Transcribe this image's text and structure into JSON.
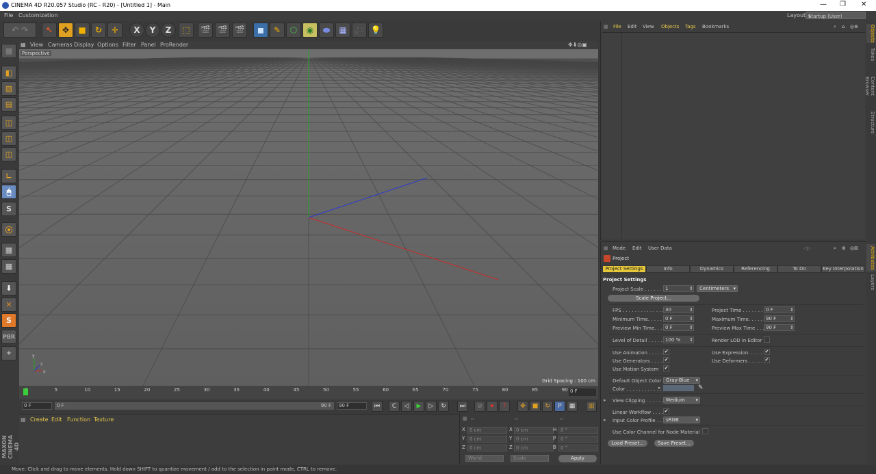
{
  "window": {
    "title": "CINEMA 4D R20.057 Studio (RC - R20) - [Untitled 1] - Main",
    "buttons": [
      "—",
      "❐",
      "✕"
    ]
  },
  "menubar": {
    "items": [
      "File",
      "Customization"
    ],
    "layout_label": "Layout:",
    "layout_value": "Startup (User)"
  },
  "viewport": {
    "menu": [
      "View",
      "Cameras",
      "Display",
      "Options",
      "Filter",
      "Panel",
      "ProRender"
    ],
    "camera_label": "Perspective",
    "grid_spacing": "Grid Spacing : 100 cm",
    "axis_labels": [
      "y",
      "z",
      "x"
    ]
  },
  "timeline": {
    "ticks": [
      "0",
      "5",
      "10",
      "15",
      "20",
      "25",
      "30",
      "35",
      "40",
      "45",
      "50",
      "55",
      "60",
      "65",
      "70",
      "75",
      "80",
      "85",
      "90"
    ],
    "end_frame": "0 F",
    "start_field": "0 F",
    "current_field": "0 F",
    "max_field": "90 F",
    "end_field": "90 F"
  },
  "material_manager": {
    "menu": [
      "Create",
      "Edit",
      "Function",
      "Texture"
    ]
  },
  "coordinates": {
    "header": [
      "--",
      "--",
      "--"
    ],
    "rows": [
      {
        "a": "X",
        "av": "0 cm",
        "b": "X",
        "bv": "0 cm",
        "c": "H",
        "cv": "0 °"
      },
      {
        "a": "Y",
        "av": "0 cm",
        "b": "Y",
        "bv": "0 cm",
        "c": "P",
        "cv": "0 °"
      },
      {
        "a": "Z",
        "av": "0 cm",
        "b": "Z",
        "bv": "0 cm",
        "c": "B",
        "cv": "0 °"
      }
    ],
    "world": "World",
    "scale": "Scale",
    "apply": "Apply"
  },
  "branding": "MAXON CINEMA 4D",
  "status": "Move: Click and drag to move elements. Hold down SHIFT to quantize movement / add to the selection in point mode, CTRL to remove.",
  "object_manager": {
    "menu": [
      "File",
      "Edit",
      "View",
      "Objects",
      "Tags",
      "Bookmarks"
    ]
  },
  "side_tabs_top": [
    "Objects",
    "Takes",
    "Content Browser",
    "Structure"
  ],
  "side_tabs_bottom": [
    "Attributes",
    "Layers"
  ],
  "attributes": {
    "menu": [
      "Mode",
      "Edit",
      "User Data"
    ],
    "object": "Project",
    "tabs": [
      "Project Settings",
      "Info",
      "Dynamics",
      "Referencing",
      "To Do",
      "Key Interpolation"
    ],
    "section": "Project Settings",
    "project_scale_label": "Project Scale . . . . . . .",
    "project_scale_value": "1",
    "project_scale_unit": "Centimeters",
    "scale_project_btn": "Scale Project...",
    "fps_label": "FPS . . . . . . . . . . . . . .",
    "fps_value": "30",
    "project_time_label": "Project Time . . . . . . .",
    "project_time_value": "0 F",
    "min_time_label": "Minimum Time. . . . . .",
    "min_time_value": "0 F",
    "max_time_label": "Maximum Time. . . . . .",
    "max_time_value": "90 F",
    "prev_min_label": "Preview Min Time. . . .",
    "prev_min_value": "0 F",
    "prev_max_label": "Preview Max Time . . .",
    "prev_max_value": "90 F",
    "lod_label": "Level of Detail . . . . . .",
    "lod_value": "100 %",
    "render_lod_label": "Render LOD in Editor",
    "use_anim_label": "Use Animation . . . . . .",
    "use_expr_label": "Use Expression. . . . . .",
    "use_gen_label": "Use Generators . . . . .",
    "use_def_label": "Use Deformers . . . . . .",
    "use_motion_label": "Use Motion System",
    "def_color_label": "Default Object Color",
    "def_color_value": "Gray-Blue",
    "color_label": "Color . . . . . . . . . . . . . .",
    "view_clip_label": "View Clipping . . . . . .",
    "view_clip_value": "Medium",
    "linear_wf_label": "Linear Workflow . . . .",
    "input_cp_label": "Input Color Profile . .",
    "input_cp_value": "sRGB",
    "node_mat_label": "Use Color Channel for Node Material",
    "load_preset": "Load Preset...",
    "save_preset": "Save Preset...",
    "check": "✔",
    "arrow": "▸",
    "spin": "⇕",
    "drop": "▾"
  },
  "colors": {
    "accent": "#e6c83a",
    "x_axis": "#cc2a2a",
    "y_axis": "#2aa02a",
    "z_axis": "#2a3acc"
  }
}
